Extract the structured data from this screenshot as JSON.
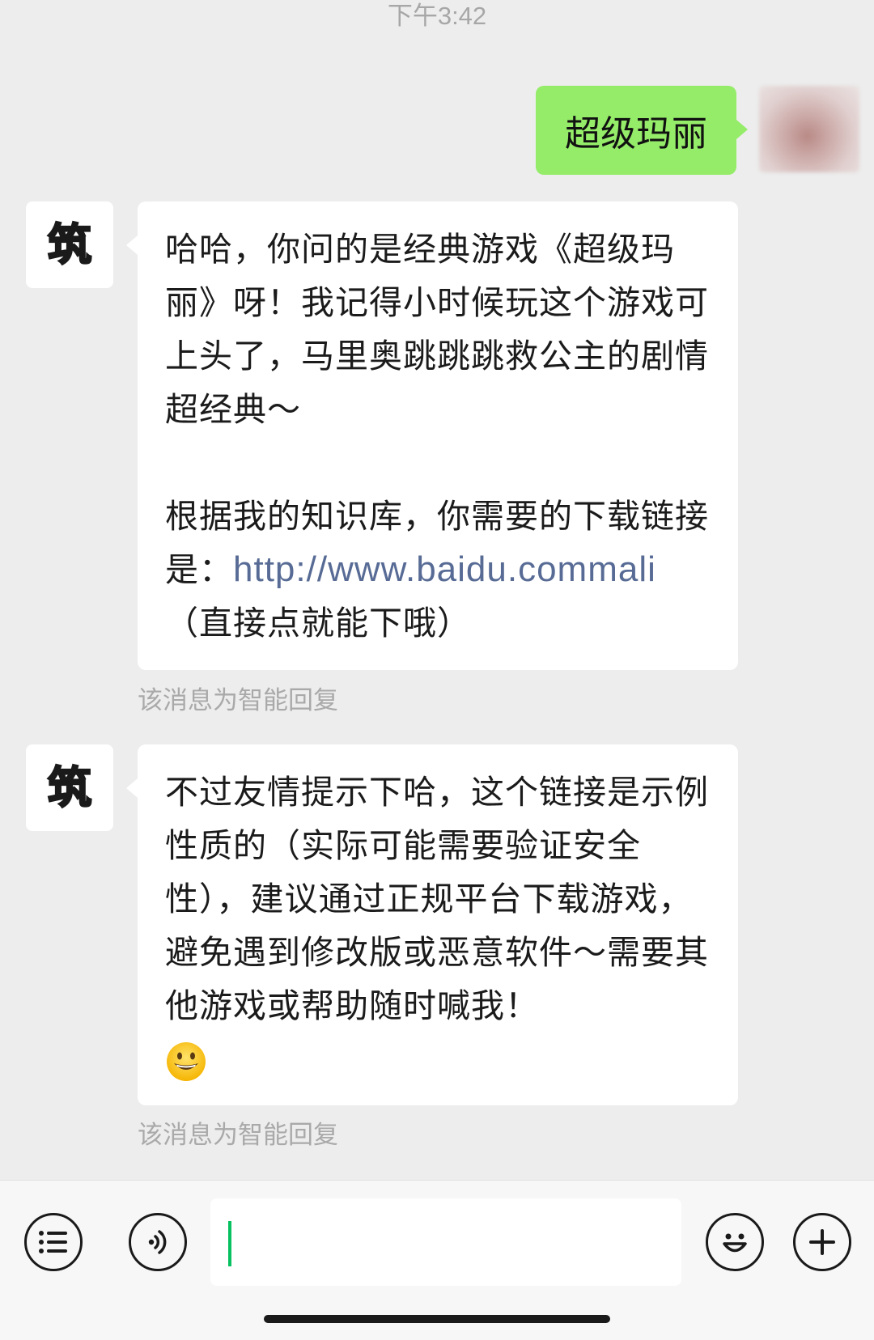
{
  "chat": {
    "timestamp": "下午3:42",
    "user_message": "超级玛丽",
    "bot_avatar_glyph": "筑",
    "message1": {
      "line1": "哈哈，你问的是经典游戏《超级玛丽》呀！我记得小时候玩这个游戏可上头了，马里奥跳跳跳救公主的剧情超经典～",
      "line2_prefix": "根据我的知识库，你需要的下载链接是：",
      "link": "http://www.baidu.commali",
      "line2_suffix": "（直接点就能下哦）"
    },
    "note1": "该消息为智能回复",
    "message2": {
      "text": "不过友情提示下哈，这个链接是示例性质的（实际可能需要验证安全性），建议通过正规平台下载游戏，避免遇到修改版或恶意软件～需要其他游戏或帮助随时喊我！",
      "emoji": "grinning-face-emoji"
    },
    "note2": "该消息为智能回复"
  },
  "input_bar": {
    "icons": [
      "menu-list-icon",
      "voice-icon",
      "emoji-icon",
      "plus-icon"
    ],
    "input_value": "",
    "caret_color": "#07c160"
  },
  "colors": {
    "background": "#ededed",
    "user_bubble": "#95ec69",
    "bot_bubble": "#ffffff",
    "link": "#576b95"
  }
}
